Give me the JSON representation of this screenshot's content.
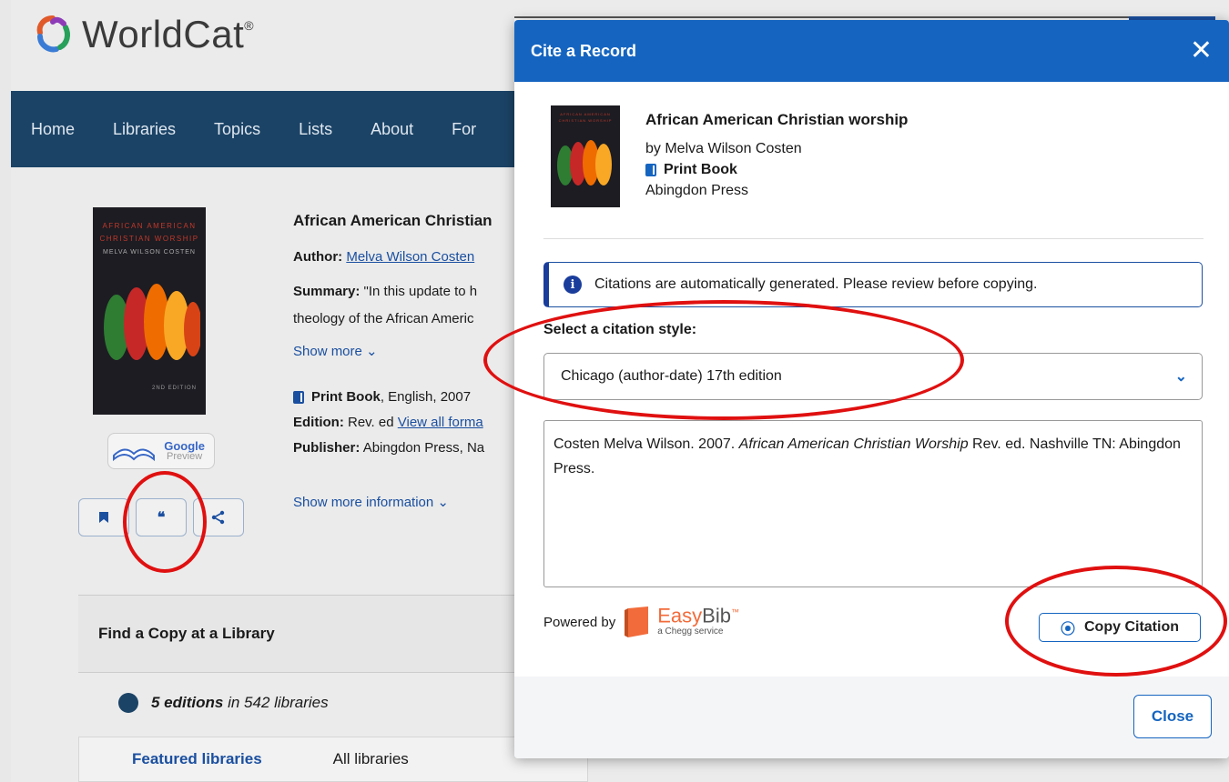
{
  "site": {
    "logo_text": "WorldCat",
    "logo_reg": "®"
  },
  "nav": {
    "items": [
      "Home",
      "Libraries",
      "Topics",
      "Lists",
      "About",
      "For"
    ]
  },
  "record_page": {
    "title": "African American Christian",
    "author_label": "Author:",
    "author_value": "Melva Wilson Costen",
    "summary_label": "Summary:",
    "summary_line1": "\"In this update to h",
    "summary_line2": "theology of the African Americ",
    "show_more": "Show more ⌄",
    "format_label": "Print Book",
    "format_rest": ", English, 2007",
    "edition_label": "Edition:",
    "edition_value": "Rev. ed",
    "edition_link": "View all forma",
    "publisher_label": "Publisher:",
    "publisher_value": "Abingdon Press, Na",
    "show_more_info": "Show more information ⌄",
    "cover": {
      "title_line1": "AFRICAN AMERICAN",
      "title_line2": "CHRISTIAN WORSHIP",
      "author": "MELVA WILSON COSTEN",
      "edition": "2ND EDITION"
    },
    "google_preview": {
      "line1": "Google",
      "line2": "Preview"
    },
    "find_copy": "Find a Copy at a Library",
    "editions_bold": "5 editions",
    "editions_rest": " in 542 libraries",
    "tabs": [
      "Featured libraries",
      "All libraries"
    ]
  },
  "modal": {
    "title": "Cite a Record",
    "close_x": "✕",
    "record": {
      "title": "African American Christian worship",
      "byline": "by Melva Wilson Costen",
      "format": "Print Book",
      "publisher": "Abingdon Press"
    },
    "notice": "Citations are automatically generated. Please review before copying.",
    "notice_icon": "i",
    "select_label": "Select a citation style:",
    "select_value": "Chicago (author-date) 17th edition",
    "citation": {
      "part1": "Costen Melva Wilson. 2007. ",
      "italic": "African American Christian Worship",
      "part2": " Rev. ed. Nashville TN: Abingdon Press."
    },
    "powered_by": "Powered by",
    "easybib": {
      "brand_a": "Easy",
      "brand_b": "Bib",
      "tm": "™",
      "sub": "a Chegg service"
    },
    "copy_button": "Copy Citation",
    "close_button": "Close"
  },
  "colors": {
    "modal_header": "#1565c0",
    "navbar": "#1b4366",
    "annotation": "#e01010",
    "easybib": "#f26b3a"
  }
}
